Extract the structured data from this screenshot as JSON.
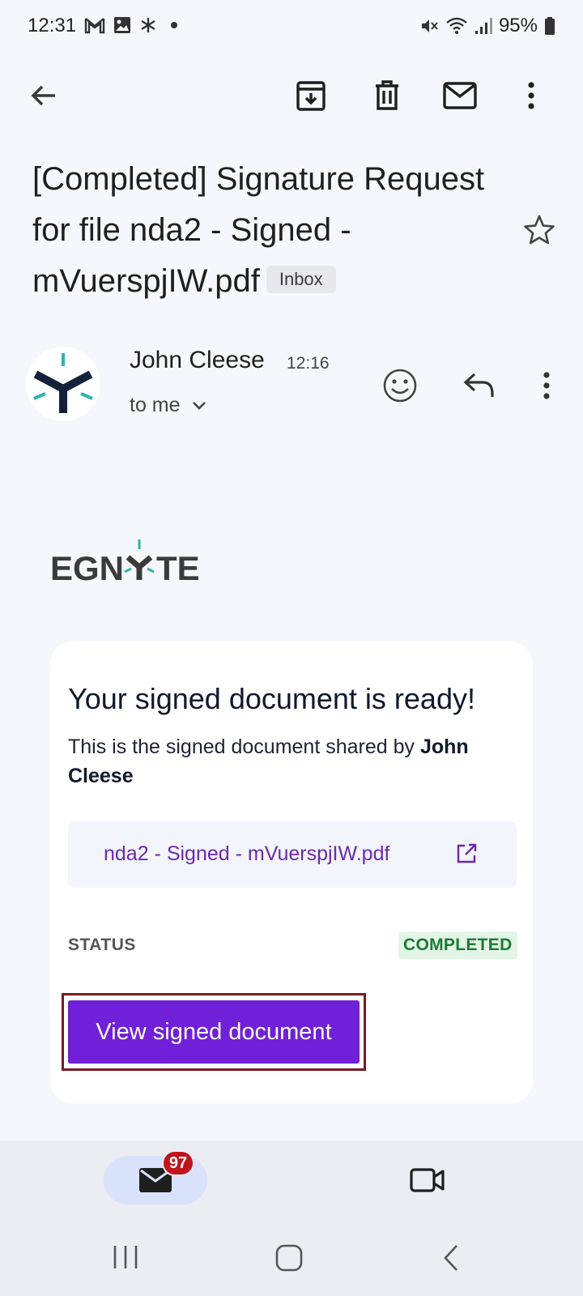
{
  "status_bar": {
    "time": "12:31",
    "battery": "95%"
  },
  "email": {
    "subject": "[Completed] Signature Request for file nda2 - Signed - mVuerspjIW.pdf",
    "label": "Inbox",
    "sender": "John Cleese",
    "time": "12:16",
    "recipient": "to me"
  },
  "body": {
    "brand": "EGNYTE",
    "title": "Your signed document is ready!",
    "description_prefix": "This is the signed document shared by ",
    "description_name": "John Cleese",
    "file_name": "nda2 - Signed - mVuerspjIW.pdf",
    "status_label": "STATUS",
    "status_value": "COMPLETED",
    "button_label": "View signed document"
  },
  "bottom_nav": {
    "mail_badge": "97"
  },
  "colors": {
    "accent": "#7020d8",
    "link": "#6d28b0",
    "status_green": "#1a7a32",
    "badge_red": "#c0141a"
  }
}
